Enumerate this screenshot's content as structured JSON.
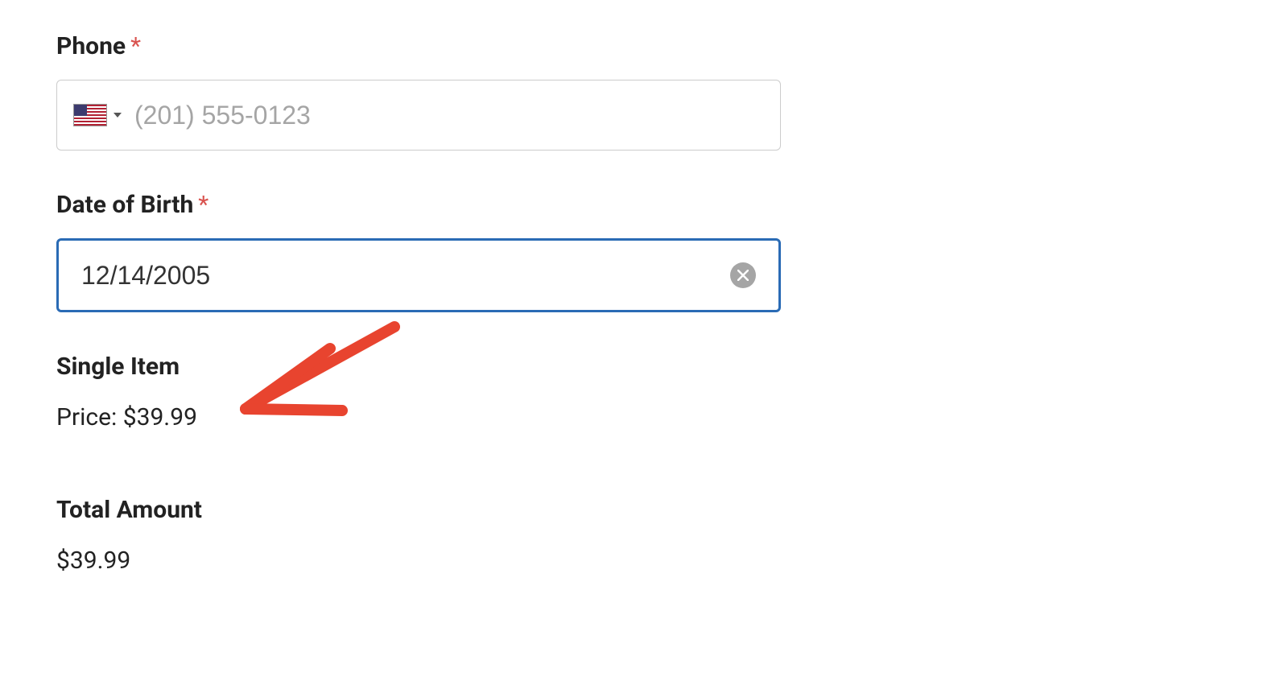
{
  "phone": {
    "label": "Phone",
    "required_mark": "*",
    "placeholder": "(201) 555-0123",
    "value": ""
  },
  "dob": {
    "label": "Date of Birth",
    "required_mark": "*",
    "value": "12/14/2005"
  },
  "single_item": {
    "heading": "Single Item",
    "price_label": "Price: ",
    "price_value": "$39.99"
  },
  "total": {
    "heading": "Total Amount",
    "value": "$39.99"
  }
}
